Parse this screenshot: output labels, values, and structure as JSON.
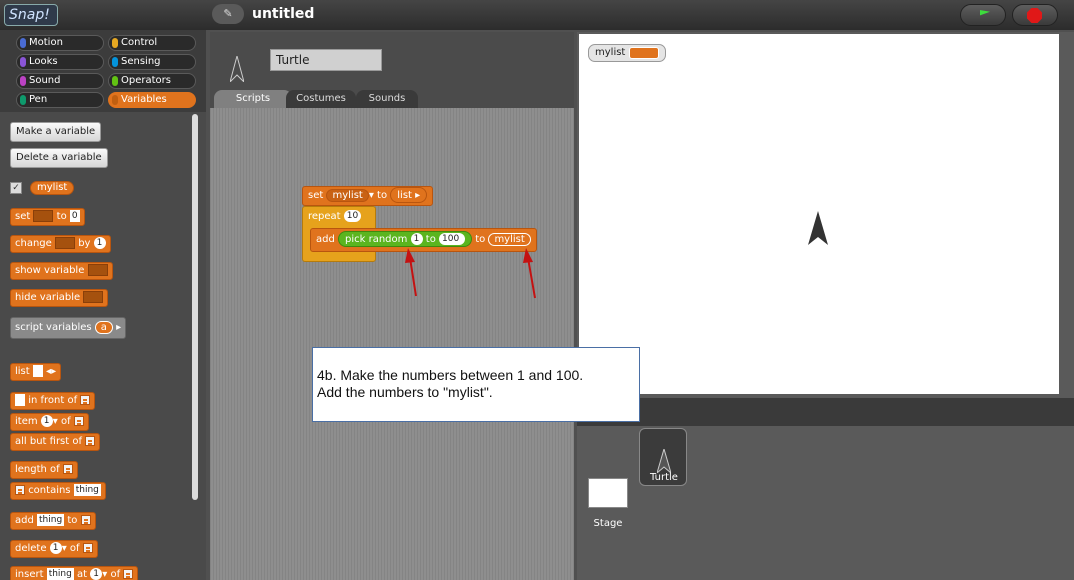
{
  "app": {
    "logo": "Snap!",
    "project_title": "untitled",
    "edit_icon": "pencil-icon"
  },
  "categories": [
    {
      "label": "Motion",
      "color": "#4a6cd4"
    },
    {
      "label": "Control",
      "color": "#e6a822"
    },
    {
      "label": "Looks",
      "color": "#8a55d7"
    },
    {
      "label": "Sensing",
      "color": "#0494dc"
    },
    {
      "label": "Sound",
      "color": "#bb42c3"
    },
    {
      "label": "Operators",
      "color": "#62c213"
    },
    {
      "label": "Pen",
      "color": "#0e9a6c"
    },
    {
      "label": "Variables",
      "color": "#e0731d"
    }
  ],
  "palette": {
    "make_variable": "Make a variable",
    "delete_variable": "Delete a variable",
    "var_checked": "✓",
    "var_name": "mylist",
    "set_label": "set",
    "set_to": "to",
    "set_value": "0",
    "change_label": "change",
    "change_by": "by",
    "change_value": "1",
    "show_variable": "show variable",
    "hide_variable": "hide variable",
    "script_variables": "script variables",
    "script_var_a": "a",
    "list_label": "list",
    "in_front_of": "in front of",
    "item_label": "item",
    "item_value": "1",
    "of_label": "of",
    "all_but_first_of": "all but first of",
    "length_of": "length of",
    "contains": "contains",
    "thing": "thing",
    "add_label": "add",
    "to_label": "to",
    "delete_label": "delete",
    "delete_value": "1",
    "insert_label": "insert",
    "at_label": "at",
    "insert_value": "1"
  },
  "sprite": {
    "name": "Turtle",
    "tabs": [
      "Scripts",
      "Costumes",
      "Sounds"
    ],
    "active_tab": "Scripts"
  },
  "script": {
    "set": "set",
    "set_var": "mylist",
    "to": "to",
    "list": "list",
    "repeat": "repeat",
    "repeat_count": "10",
    "add": "add",
    "pick_random": "pick random",
    "from": "1",
    "to2": "to",
    "max": "100",
    "to3": "to",
    "target": "mylist"
  },
  "stage": {
    "watcher_name": "mylist"
  },
  "corral": {
    "sprite_label": "Turtle",
    "stage_label": "Stage"
  },
  "callout": {
    "line1": "4b.  Make the numbers between 1 and 100.",
    "line2": "Add the numbers to \"mylist\"."
  }
}
